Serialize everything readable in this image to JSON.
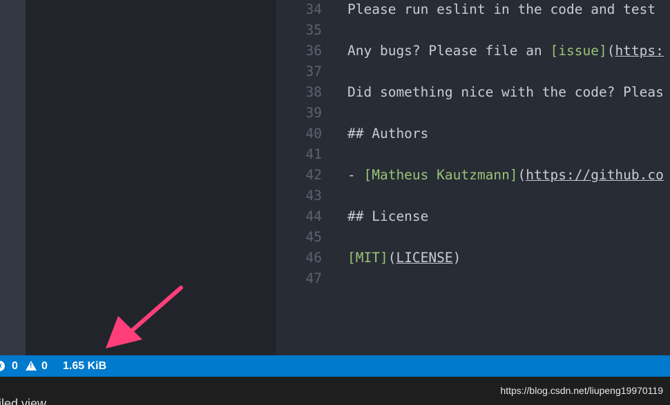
{
  "editor": {
    "lines": [
      {
        "num": "34",
        "segments": [
          {
            "text": "Please run eslint in the code and test",
            "kind": "plain"
          }
        ]
      },
      {
        "num": "35",
        "segments": []
      },
      {
        "num": "36",
        "segments": [
          {
            "text": "Any bugs? Please file an ",
            "kind": "plain"
          },
          {
            "text": "[issue]",
            "kind": "link"
          },
          {
            "text": "(",
            "kind": "plain"
          },
          {
            "text": "https:",
            "kind": "url"
          }
        ]
      },
      {
        "num": "37",
        "segments": []
      },
      {
        "num": "38",
        "segments": [
          {
            "text": "Did something nice with the code? Pleas",
            "kind": "plain"
          }
        ]
      },
      {
        "num": "39",
        "segments": []
      },
      {
        "num": "40",
        "segments": [
          {
            "text": "## Authors",
            "kind": "plain"
          }
        ]
      },
      {
        "num": "41",
        "segments": []
      },
      {
        "num": "42",
        "segments": [
          {
            "text": "- ",
            "kind": "plain"
          },
          {
            "text": "[Matheus Kautzmann]",
            "kind": "link"
          },
          {
            "text": "(",
            "kind": "plain"
          },
          {
            "text": "https://github.co",
            "kind": "url"
          }
        ]
      },
      {
        "num": "43",
        "segments": []
      },
      {
        "num": "44",
        "segments": [
          {
            "text": "## License",
            "kind": "plain"
          }
        ]
      },
      {
        "num": "45",
        "segments": []
      },
      {
        "num": "46",
        "segments": [
          {
            "text": "[MIT]",
            "kind": "link"
          },
          {
            "text": "(",
            "kind": "plain"
          },
          {
            "text": "LICENSE",
            "kind": "url"
          },
          {
            "text": ")",
            "kind": "plain"
          }
        ]
      },
      {
        "num": "47",
        "segments": []
      }
    ]
  },
  "status_bar": {
    "errors_count": "0",
    "warnings_count": "0",
    "file_size": "1.65 KiB",
    "error_icon": "error-circle-icon",
    "warning_icon": "warning-triangle-icon",
    "background_color": "#007acc"
  },
  "bottom_panel": {
    "partial_text": "piled view",
    "watermark": "https://blog.csdn.net/liupeng19970119"
  },
  "annotation": {
    "icon": "arrow-icon",
    "color": "#ff3f7a"
  }
}
